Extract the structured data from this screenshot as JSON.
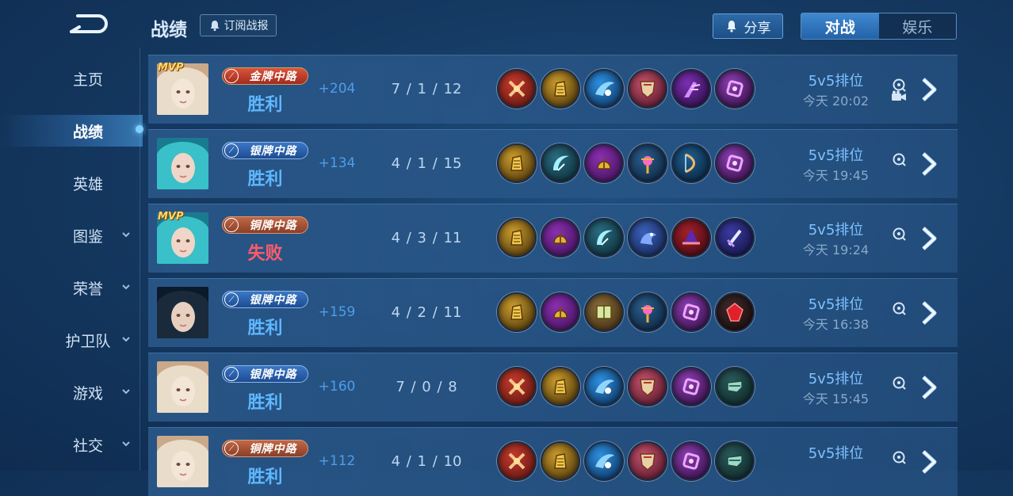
{
  "header": {
    "title": "战绩",
    "subscribe_label": "订阅战报",
    "share_label": "分享",
    "tabs": [
      {
        "label": "对战",
        "active": true
      },
      {
        "label": "娱乐",
        "active": false
      }
    ]
  },
  "sidebar": {
    "items": [
      {
        "label": "主页",
        "active": false,
        "expandable": false
      },
      {
        "label": "战绩",
        "active": true,
        "expandable": false
      },
      {
        "label": "英雄",
        "active": false,
        "expandable": false
      },
      {
        "label": "图鉴",
        "active": false,
        "expandable": true
      },
      {
        "label": "荣誉",
        "active": false,
        "expandable": true
      },
      {
        "label": "护卫队",
        "active": false,
        "expandable": true
      },
      {
        "label": "游戏",
        "active": false,
        "expandable": true
      },
      {
        "label": "社交",
        "active": false,
        "expandable": true
      }
    ]
  },
  "matches": [
    {
      "mvp": "MVP",
      "hero": "silver-haired-hero",
      "badge": "金牌中路",
      "badge_color": "red",
      "result": "胜利",
      "outcome": "win",
      "score": "+204",
      "kda": "7 / 1 / 12",
      "mode": "5v5排位",
      "time": "今天 20:02",
      "has_video": true,
      "items": [
        "red-cross-relic",
        "gold-gauntlet",
        "blue-wing",
        "crimson-shield",
        "purple-claw",
        "violet-glyph"
      ]
    },
    {
      "mvp": "",
      "hero": "teal-haired-hero",
      "badge": "银牌中路",
      "badge_color": "blue",
      "result": "胜利",
      "outcome": "win",
      "score": "+134",
      "kda": "4 / 1 / 15",
      "mode": "5v5排位",
      "time": "今天 19:45",
      "has_video": false,
      "items": [
        "gold-gauntlet",
        "teal-scythe",
        "gold-helmet",
        "teal-orb-staff",
        "azure-bow",
        "violet-glyph"
      ]
    },
    {
      "mvp": "MVP",
      "hero": "teal-haired-hero",
      "badge": "铜牌中路",
      "badge_color": "bronze",
      "result": "失败",
      "outcome": "lose",
      "score": "",
      "kda": "4 / 3 / 11",
      "mode": "5v5排位",
      "time": "今天 19:24",
      "has_video": false,
      "items": [
        "gold-gauntlet",
        "gold-helmet",
        "teal-scythe",
        "blue-dragon",
        "crimson-hat",
        "violet-sword"
      ]
    },
    {
      "mvp": "",
      "hero": "dark-haired-hero",
      "badge": "银牌中路",
      "badge_color": "blue",
      "result": "胜利",
      "outcome": "win",
      "score": "+159",
      "kda": "4 / 2 / 11",
      "mode": "5v5排位",
      "time": "今天 16:38",
      "has_video": false,
      "items": [
        "gold-gauntlet",
        "gold-helmet",
        "green-tome",
        "teal-orb-staff",
        "violet-glyph",
        "red-gem"
      ]
    },
    {
      "mvp": "",
      "hero": "silver-haired-hero",
      "badge": "银牌中路",
      "badge_color": "blue",
      "result": "胜利",
      "outcome": "win",
      "score": "+160",
      "kda": "7 / 0 / 8",
      "mode": "5v5排位",
      "time": "今天 15:45",
      "has_video": false,
      "items": [
        "red-cross-relic",
        "gold-gauntlet",
        "blue-wing",
        "crimson-shield",
        "violet-glyph",
        "teal-boots"
      ]
    },
    {
      "mvp": "",
      "hero": "silver-haired-hero",
      "badge": "铜牌中路",
      "badge_color": "bronze",
      "result": "胜利",
      "outcome": "win",
      "score": "+112",
      "kda": "4 / 1 / 10",
      "mode": "5v5排位",
      "time": "",
      "has_video": false,
      "items": [
        "red-cross-relic",
        "gold-gauntlet",
        "blue-wing",
        "crimson-shield",
        "violet-glyph",
        "teal-boots"
      ]
    }
  ]
}
